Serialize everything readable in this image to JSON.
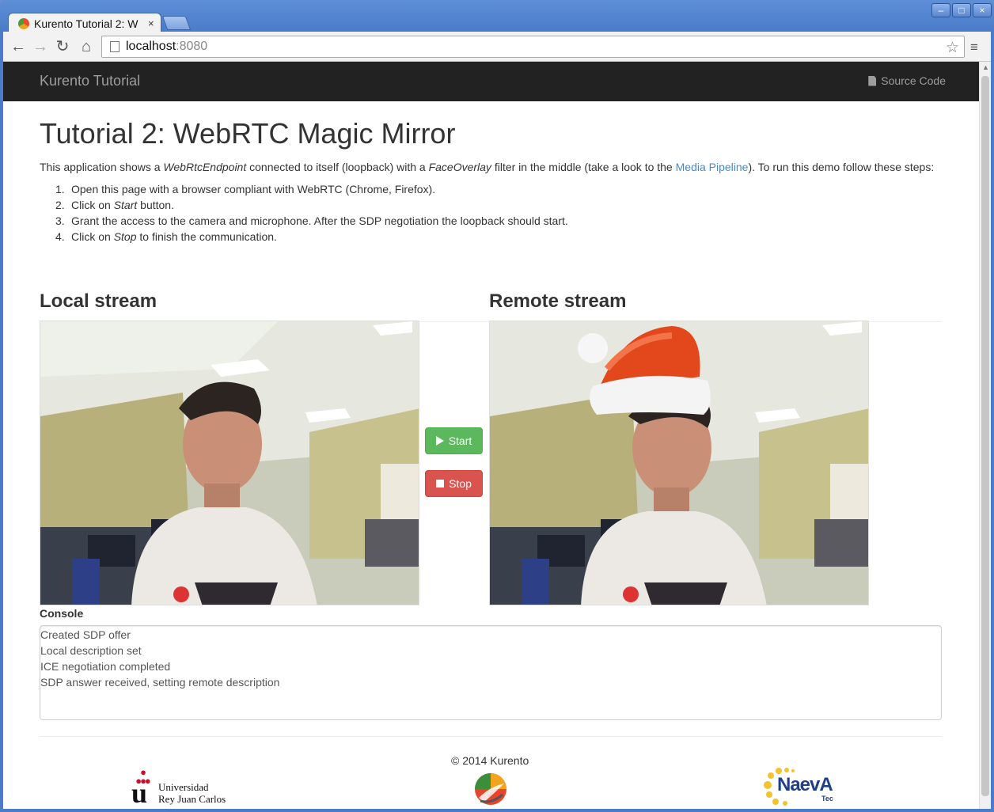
{
  "browser": {
    "tab_title": "Kurento Tutorial 2: W",
    "tab_close": "×",
    "url_host": "localhost",
    "url_port": ":8080",
    "window_controls": {
      "minimize": "–",
      "maximize": "□",
      "close": "×"
    }
  },
  "navbar": {
    "brand": "Kurento Tutorial",
    "source_code": "Source Code"
  },
  "page": {
    "title": "Tutorial 2: WebRTC Magic Mirror",
    "intro": {
      "p1": "This application shows a ",
      "em1": "WebRtcEndpoint",
      "p2": " connected to itself (loopback) with a ",
      "em2": "FaceOverlay",
      "p3": " filter in the middle (take a look to the ",
      "link": "Media Pipeline",
      "p4": "). To run this demo follow these steps:"
    },
    "steps": [
      {
        "num": "1.",
        "a": "Open this page with a browser compliant with WebRTC (Chrome, Firefox).",
        "em": "",
        "b": ""
      },
      {
        "num": "2.",
        "a": "Click on ",
        "em": "Start",
        "b": " button."
      },
      {
        "num": "3.",
        "a": "Grant the access to the camera and microphone. After the SDP negotiation the loopback should start.",
        "em": "",
        "b": ""
      },
      {
        "num": "4.",
        "a": "Click on ",
        "em": "Stop",
        "b": " to finish the communication."
      }
    ],
    "local_stream_title": "Local stream",
    "remote_stream_title": "Remote stream",
    "start_label": "Start",
    "stop_label": "Stop",
    "console_label": "Console",
    "console_lines": [
      "Created SDP offer",
      "Local description set",
      "ICE negotiation completed",
      "SDP answer received, setting remote description"
    ],
    "copyright": "© 2014 Kurento"
  },
  "footer_logos": {
    "urjc_line1": "Universidad",
    "urjc_line2": "Rey Juan Carlos",
    "naeva_name": "NaevA",
    "naeva_sub": "Tec"
  },
  "colors": {
    "start_button": "#5cb85c",
    "stop_button": "#d9534f",
    "link": "#428bca",
    "navbar": "#222222"
  }
}
